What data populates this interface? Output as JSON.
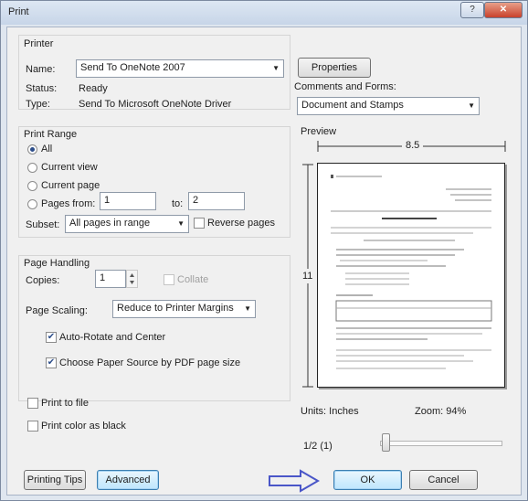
{
  "window": {
    "title": "Print",
    "help_glyph": "?",
    "close_glyph": "✕"
  },
  "printer": {
    "group_label": "Printer",
    "name_label": "Name:",
    "name_value": "Send To OneNote 2007",
    "status_label": "Status:",
    "status_value": "Ready",
    "type_label": "Type:",
    "type_value": "Send To Microsoft OneNote Driver",
    "properties_button": "Properties",
    "comments_label": "Comments and Forms:",
    "comments_value": "Document and Stamps"
  },
  "print_range": {
    "group_label": "Print Range",
    "options": [
      "All",
      "Current view",
      "Current page",
      "Pages from:"
    ],
    "selected_option": "All",
    "from_value": "1",
    "to_label": "to:",
    "to_value": "2",
    "subset_label": "Subset:",
    "subset_value": "All pages in range",
    "reverse_label": "Reverse pages",
    "reverse_checked": false
  },
  "page_handling": {
    "group_label": "Page Handling",
    "copies_label": "Copies:",
    "copies_value": "1",
    "collate_label": "Collate",
    "collate_checked": false,
    "scaling_label": "Page Scaling:",
    "scaling_value": "Reduce to Printer Margins",
    "auto_rotate_label": "Auto-Rotate and Center",
    "auto_rotate_checked": true,
    "paper_source_label": "Choose Paper Source by PDF page size",
    "paper_source_checked": true
  },
  "options": {
    "print_to_file_label": "Print to file",
    "print_to_file_checked": false,
    "print_black_label": "Print color as black",
    "print_black_checked": false
  },
  "preview": {
    "label": "Preview",
    "width_label": "8.5",
    "height_label": "11",
    "units_text": "Units: Inches",
    "zoom_text": "Zoom: 94%",
    "page_indicator": "1/2 (1)"
  },
  "footer": {
    "printing_tips_button": "Printing Tips",
    "advanced_button": "Advanced",
    "ok_button": "OK",
    "cancel_button": "Cancel"
  },
  "colors": {
    "arrow_annotation": "#4a56c8"
  }
}
